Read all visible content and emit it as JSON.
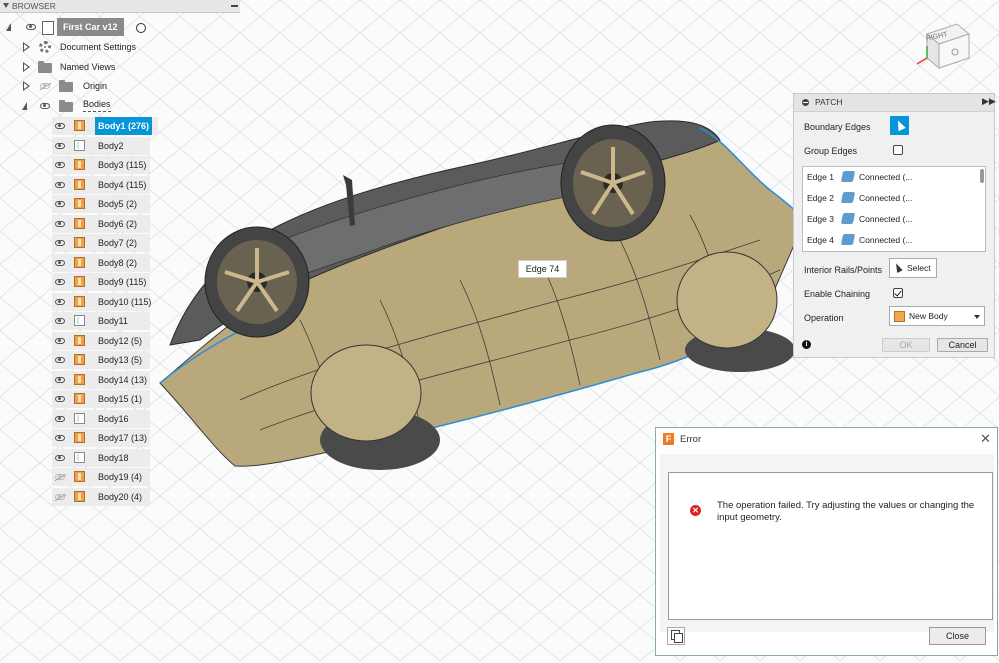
{
  "browser": {
    "title": "BROWSER",
    "document": "First Car v12",
    "items": [
      {
        "label": "Document Settings"
      },
      {
        "label": "Named Views"
      },
      {
        "label": "Origin"
      },
      {
        "label": "Bodies"
      }
    ],
    "bodies": [
      {
        "label": "Body1 (276)",
        "kind": "solid",
        "visible": true,
        "selected": true
      },
      {
        "label": "Body2",
        "kind": "surface",
        "visible": true
      },
      {
        "label": "Body3 (115)",
        "kind": "solid",
        "visible": true
      },
      {
        "label": "Body4 (115)",
        "kind": "solid",
        "visible": true
      },
      {
        "label": "Body5 (2)",
        "kind": "solid",
        "visible": true
      },
      {
        "label": "Body6 (2)",
        "kind": "solid",
        "visible": true
      },
      {
        "label": "Body7 (2)",
        "kind": "solid",
        "visible": true
      },
      {
        "label": "Body8 (2)",
        "kind": "solid",
        "visible": true
      },
      {
        "label": "Body9 (115)",
        "kind": "solid",
        "visible": true
      },
      {
        "label": "Body10 (115)",
        "kind": "solid",
        "visible": true
      },
      {
        "label": "Body11",
        "kind": "surface",
        "visible": true
      },
      {
        "label": "Body12 (5)",
        "kind": "solid",
        "visible": true
      },
      {
        "label": "Body13 (5)",
        "kind": "solid",
        "visible": true
      },
      {
        "label": "Body14 (13)",
        "kind": "solid",
        "visible": true
      },
      {
        "label": "Body15 (1)",
        "kind": "solid",
        "visible": true
      },
      {
        "label": "Body16",
        "kind": "surface",
        "visible": true
      },
      {
        "label": "Body17 (13)",
        "kind": "solid",
        "visible": true
      },
      {
        "label": "Body18",
        "kind": "surface",
        "visible": true
      },
      {
        "label": "Body19 (4)",
        "kind": "solid",
        "visible": false
      },
      {
        "label": "Body20 (4)",
        "kind": "solid",
        "visible": false
      }
    ]
  },
  "viewcube": {
    "face": "RIGHT"
  },
  "tooltip": {
    "text": "Edge 74"
  },
  "patch": {
    "title": "PATCH",
    "boundary_edges_label": "Boundary Edges",
    "group_edges_label": "Group Edges",
    "edges": [
      {
        "name": "Edge 1",
        "value": "Connected (..."
      },
      {
        "name": "Edge 2",
        "value": "Connected (..."
      },
      {
        "name": "Edge 3",
        "value": "Connected (..."
      },
      {
        "name": "Edge 4",
        "value": "Connected (..."
      }
    ],
    "interior_label": "Interior Rails/Points",
    "select_label": "Select",
    "chaining_label": "Enable Chaining",
    "operation_label": "Operation",
    "operation_value": "New Body",
    "ok_label": "OK",
    "cancel_label": "Cancel",
    "info": "i"
  },
  "error": {
    "title": "Error",
    "message": "The operation failed. Try adjusting the values or changing the input geometry.",
    "close_label": "Close",
    "app_letter": "F",
    "close_glyph": "✕",
    "error_glyph": "✕"
  },
  "colors": {
    "accent": "#0696d7",
    "body_fill": "#b7a77f",
    "grid": "#d6dbe0"
  }
}
